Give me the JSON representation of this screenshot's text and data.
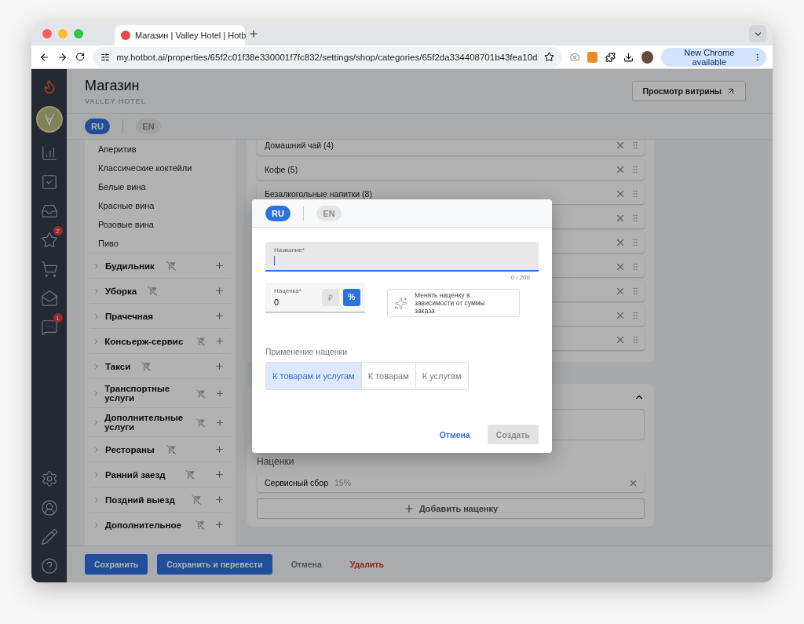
{
  "browser": {
    "tab_title": "Магазин | Valley Hotel | Hotb",
    "url": "my.hotbot.ai/properties/65f2c01f38e330001f7fc832/settings/shop/categories/65f2da334408701b43fea10d",
    "update_button": "New Chrome available"
  },
  "nav": {
    "items": [
      {
        "kind": "analytics"
      },
      {
        "kind": "tasks"
      },
      {
        "kind": "inbox"
      },
      {
        "kind": "reviews",
        "badge": "2"
      },
      {
        "kind": "shop"
      },
      {
        "kind": "mail"
      },
      {
        "kind": "chat",
        "badge": "1"
      }
    ]
  },
  "header": {
    "title": "Магазин",
    "subtitle": "VALLEY HOTEL",
    "preview_button": "Просмотр витрины"
  },
  "languages": [
    {
      "label": "RU",
      "selected": true
    },
    {
      "label": "EN",
      "selected": false
    }
  ],
  "categories": {
    "subitems": [
      "Аперитив",
      "Классические коктейли",
      "Белые вина",
      "Красные вина",
      "Розовые вина",
      "Пиво"
    ],
    "groups": [
      {
        "label": "Будильник",
        "hidden_from_shop": true
      },
      {
        "label": "Уборка",
        "hidden_from_shop": true
      },
      {
        "label": "Прачечная",
        "hidden_from_shop": false
      },
      {
        "label": "Консьерж-сервис",
        "hidden_from_shop": true
      },
      {
        "label": "Такси",
        "hidden_from_shop": true
      },
      {
        "label": "Транспортные услуги",
        "hidden_from_shop": true
      },
      {
        "label": "Дополнительные услуги",
        "hidden_from_shop": true
      },
      {
        "label": "Рестораны",
        "hidden_from_shop": true
      },
      {
        "label": "Ранний заезд",
        "hidden_from_shop": true
      },
      {
        "label": "Поздний выезд",
        "hidden_from_shop": true
      },
      {
        "label": "Дополнительное",
        "hidden_from_shop": true
      }
    ]
  },
  "products": [
    {
      "label": "Домашний чай (4)"
    },
    {
      "label": "Кофе (5)"
    },
    {
      "label": "Безалкогольные напитки (8)"
    }
  ],
  "markups": {
    "title": "Наценки",
    "items": [
      {
        "name": "Сервисный сбор",
        "value": "15%"
      }
    ],
    "add_button": "Добавить наценку"
  },
  "footer": {
    "buttons": [
      {
        "label": "Сохранить",
        "kind": "primary"
      },
      {
        "label": "Сохранить и перевести",
        "kind": "primary"
      },
      {
        "label": "Отмена",
        "kind": "text"
      },
      {
        "label": "Удалить",
        "kind": "danger"
      }
    ]
  },
  "dialog": {
    "languages": [
      {
        "label": "RU",
        "selected": true
      },
      {
        "label": "EN",
        "selected": false
      }
    ],
    "name_field": {
      "label": "Название*",
      "counter": "0 / 200"
    },
    "markup_field": {
      "label": "Наценка*",
      "value": "0",
      "units": [
        {
          "label": "₽",
          "selected": false
        },
        {
          "label": "%",
          "selected": true
        }
      ]
    },
    "tiered_toggle": {
      "label": "Менять наценку в зависимости от суммы заказа"
    },
    "apply_label": "Применение наценки",
    "apply_options": [
      {
        "label": "К товарам и услугам",
        "selected": true
      },
      {
        "label": "К товарам",
        "selected": false
      },
      {
        "label": "К услугам",
        "selected": false
      }
    ],
    "cancel": "Отмена",
    "create": {
      "label": "Создать",
      "disabled": true
    }
  }
}
